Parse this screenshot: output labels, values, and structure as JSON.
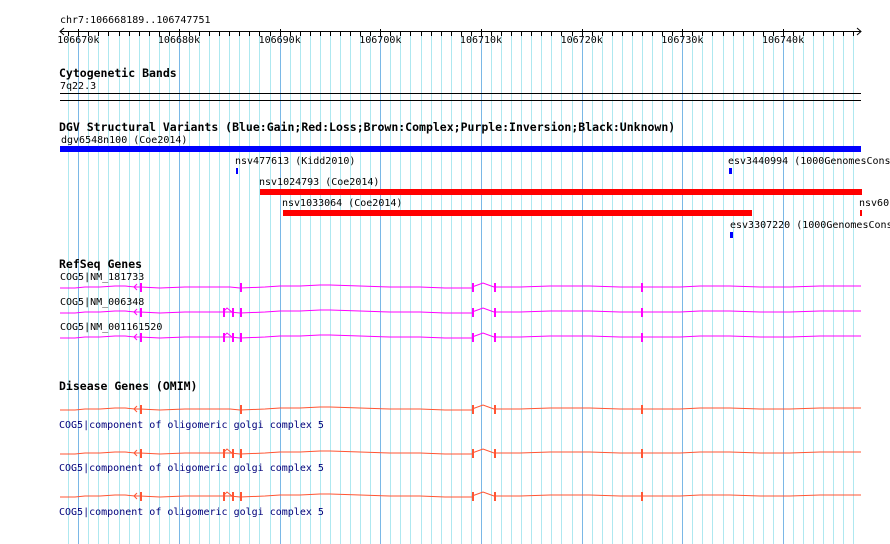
{
  "ruler": {
    "region": "chr7:106668189..106747751",
    "start": 106668189,
    "end": 106747751,
    "tick_labels": [
      "106670k",
      "106680k",
      "106690k",
      "106700k",
      "106710k",
      "106720k",
      "106730k",
      "106740k"
    ]
  },
  "cytoband": {
    "title": "Cytogenetic Bands",
    "band": "7q22.3"
  },
  "dgv": {
    "title": "DGV Structural Variants (Blue:Gain;Red:Loss;Brown:Complex;Purple:Inversion;Black:Unknown)",
    "variants": [
      {
        "label": "dgv6548n100 (Coe2014)",
        "type": "gain",
        "color": "#0000ff"
      },
      {
        "label": "nsv477613 (Kidd2010)",
        "type": "gain",
        "color": "#0000ff"
      },
      {
        "label": "esv3440994 (1000GenomesCons",
        "type": "gain",
        "color": "#0000ff"
      },
      {
        "label": "nsv1024793 (Coe2014)",
        "type": "loss",
        "color": "#ff0000"
      },
      {
        "label": "nsv1033064 (Coe2014)",
        "type": "loss",
        "color": "#ff0000"
      },
      {
        "label": "nsv60",
        "type": "loss",
        "color": "#ff0000"
      },
      {
        "label": "esv3307220 (1000GenomesCons",
        "type": "gain",
        "color": "#0000ff"
      }
    ]
  },
  "refseq": {
    "title": "RefSeq Genes",
    "color": "#ff00ff",
    "transcripts": [
      "COG5|NM_181733",
      "COG5|NM_006348",
      "COG5|NM_001161520"
    ]
  },
  "omim": {
    "title": "Disease Genes (OMIM)",
    "color": "#ff5533",
    "genes": [
      "COG5|component of oligomeric golgi complex 5",
      "COG5|component of oligomeric golgi complex 5",
      "COG5|component of oligomeric golgi complex 5"
    ]
  }
}
